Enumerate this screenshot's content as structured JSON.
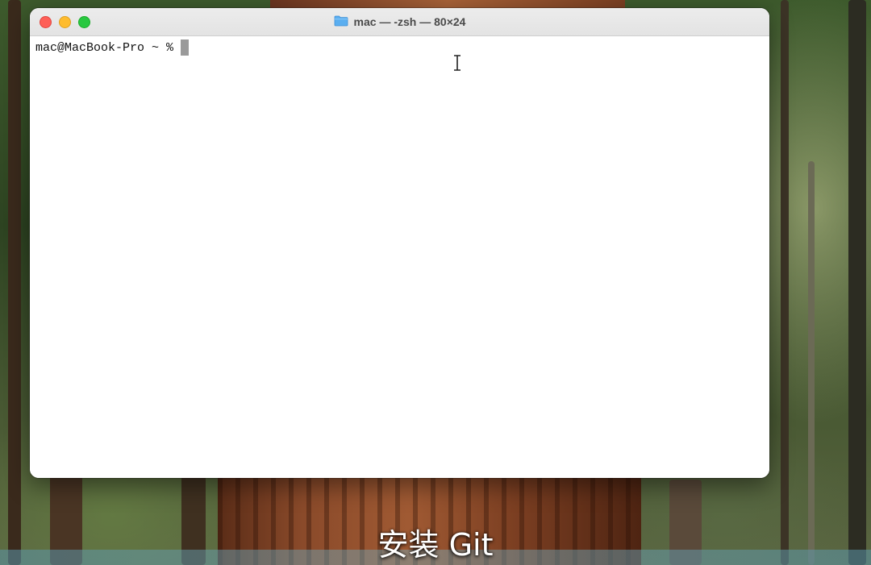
{
  "window": {
    "title": "mac — -zsh — 80×24",
    "folder_icon": "folder-icon"
  },
  "terminal": {
    "prompt": "mac@MacBook-Pro ~ %",
    "cursor": "block-cursor"
  },
  "subtitle": "安装 Git",
  "colors": {
    "close": "#fe5f57",
    "minimize": "#febc2e",
    "zoom": "#28c840",
    "terminal_bg": "#ffffff",
    "cursor": "#9a9a9a"
  }
}
